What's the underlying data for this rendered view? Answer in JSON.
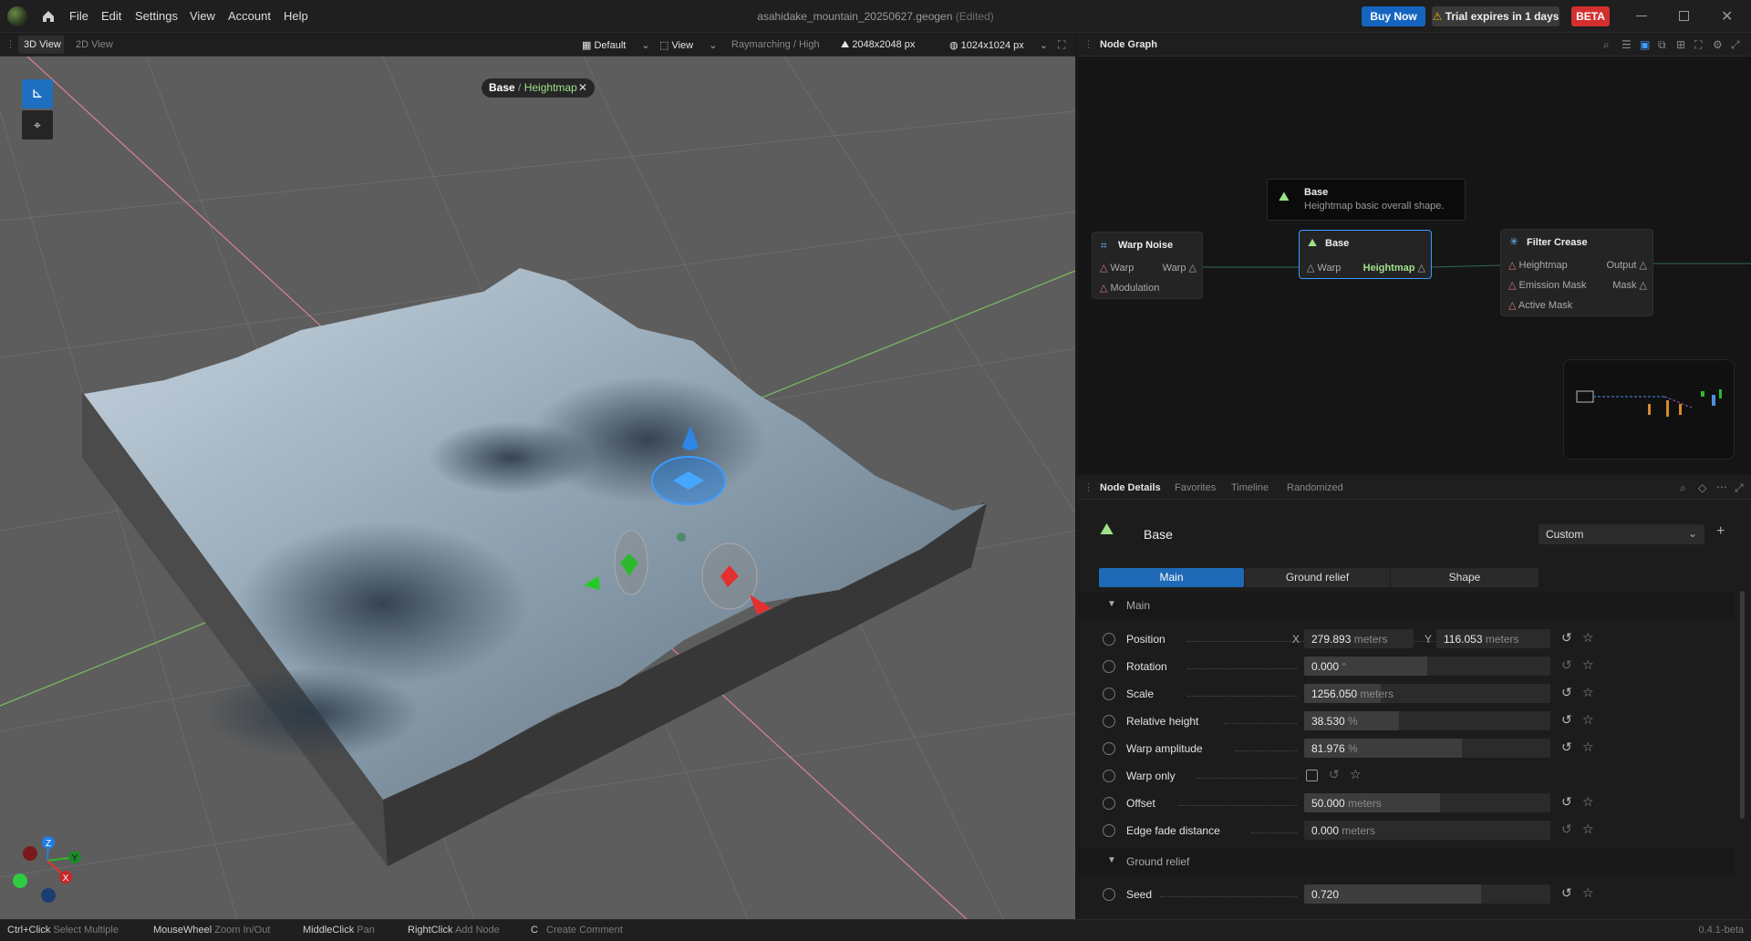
{
  "menubar": {
    "items": [
      "File",
      "Edit",
      "Settings",
      "View",
      "Account",
      "Help"
    ],
    "document_title": "asahidake_mountain_20250627.geogen",
    "edited_tag": "(Edited)",
    "buy_now": "Buy Now",
    "trial_notice": "Trial expires in 1 days",
    "beta_badge": "BETA",
    "icons": [
      "app-logo-icon",
      "home-icon",
      "minimize-icon",
      "maximize-icon",
      "close-icon",
      "warning-icon"
    ]
  },
  "viewport_toolbar": {
    "tabs": [
      "3D View",
      "2D View"
    ],
    "preset": "Default",
    "view_menu": "View",
    "render_mode": "Raymarching / High",
    "resolution": "2048x2048 px",
    "preview_resolution": "1024x1024 px"
  },
  "viewport": {
    "breadcrumb_parent": "Base",
    "breadcrumb_separator": "/",
    "breadcrumb_current": "Heightmap",
    "axis_labels": {
      "z": "Z",
      "y": "Y",
      "x": "X"
    }
  },
  "node_graph": {
    "title": "Node Graph",
    "tooltip": {
      "title": "Base",
      "description": "Heightmap basic overall shape."
    },
    "nodes": [
      {
        "title": "Warp Noise",
        "inputs": [
          "Warp",
          "Modulation"
        ],
        "outputs": [
          "Warp"
        ]
      },
      {
        "title": "Base",
        "inputs": [
          "Warp"
        ],
        "outputs": [
          "Heightmap"
        ]
      },
      {
        "title": "Filter Crease",
        "inputs": [
          "Heightmap",
          "Emission Mask",
          "Active Mask"
        ],
        "outputs": [
          "Output",
          "Mask"
        ]
      }
    ]
  },
  "details_panel": {
    "tabs": [
      "Node Details",
      "Favorites",
      "Timeline",
      "Randomized"
    ],
    "node_name": "Base",
    "preset": "Custom",
    "section_tabs": [
      "Main",
      "Ground relief",
      "Shape"
    ],
    "section_main": "Main",
    "section_ground_relief": "Ground relief",
    "x_label": "X",
    "y_label": "Y",
    "params": {
      "position": {
        "label": "Position",
        "x": "279.893",
        "y": "116.053",
        "unit": "meters"
      },
      "rotation": {
        "label": "Rotation",
        "value": "0.000",
        "unit": "°",
        "fill": 0.5
      },
      "scale": {
        "label": "Scale",
        "value": "1256.050",
        "unit": "meters",
        "fill": 0.31
      },
      "relative_height": {
        "label": "Relative height",
        "value": "38.530",
        "unit": "%",
        "fill": 0.385
      },
      "warp_amplitude": {
        "label": "Warp amplitude",
        "value": "81.976",
        "unit": "%",
        "fill": 0.64
      },
      "warp_only": {
        "label": "Warp only",
        "checked": false
      },
      "offset": {
        "label": "Offset",
        "value": "50.000",
        "unit": "meters",
        "fill": 0.55
      },
      "edge_fade": {
        "label": "Edge fade distance",
        "value": "0.000",
        "unit": "meters",
        "fill": 0.0
      },
      "seed": {
        "label": "Seed",
        "value": "0.720",
        "unit": "",
        "fill": 0.72
      }
    }
  },
  "statusbar": {
    "hints": [
      {
        "key": "Ctrl+Click",
        "desc": "Select Multiple"
      },
      {
        "key": "MouseWheel",
        "desc": "Zoom In/Out"
      },
      {
        "key": "MiddleClick",
        "desc": "Pan"
      },
      {
        "key": "RightClick",
        "desc": "Add Node"
      },
      {
        "key": "C",
        "desc": "Create Comment"
      }
    ],
    "version": "0.4.1-beta"
  }
}
